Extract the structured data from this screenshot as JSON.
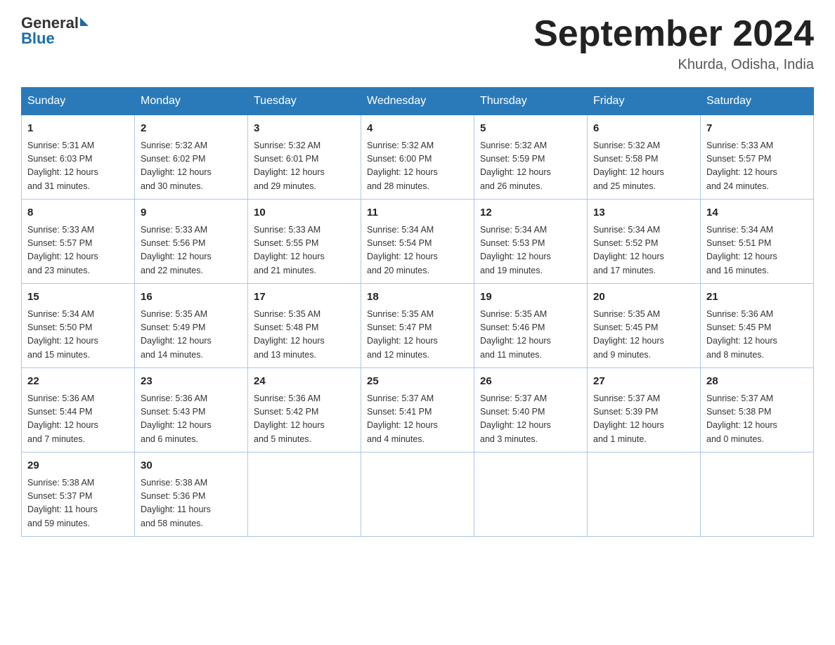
{
  "header": {
    "logo_general": "General",
    "logo_blue": "Blue",
    "title": "September 2024",
    "location": "Khurda, Odisha, India"
  },
  "days_of_week": [
    "Sunday",
    "Monday",
    "Tuesday",
    "Wednesday",
    "Thursday",
    "Friday",
    "Saturday"
  ],
  "weeks": [
    [
      {
        "day": "1",
        "sunrise": "5:31 AM",
        "sunset": "6:03 PM",
        "daylight": "12 hours and 31 minutes."
      },
      {
        "day": "2",
        "sunrise": "5:32 AM",
        "sunset": "6:02 PM",
        "daylight": "12 hours and 30 minutes."
      },
      {
        "day": "3",
        "sunrise": "5:32 AM",
        "sunset": "6:01 PM",
        "daylight": "12 hours and 29 minutes."
      },
      {
        "day": "4",
        "sunrise": "5:32 AM",
        "sunset": "6:00 PM",
        "daylight": "12 hours and 28 minutes."
      },
      {
        "day": "5",
        "sunrise": "5:32 AM",
        "sunset": "5:59 PM",
        "daylight": "12 hours and 26 minutes."
      },
      {
        "day": "6",
        "sunrise": "5:32 AM",
        "sunset": "5:58 PM",
        "daylight": "12 hours and 25 minutes."
      },
      {
        "day": "7",
        "sunrise": "5:33 AM",
        "sunset": "5:57 PM",
        "daylight": "12 hours and 24 minutes."
      }
    ],
    [
      {
        "day": "8",
        "sunrise": "5:33 AM",
        "sunset": "5:57 PM",
        "daylight": "12 hours and 23 minutes."
      },
      {
        "day": "9",
        "sunrise": "5:33 AM",
        "sunset": "5:56 PM",
        "daylight": "12 hours and 22 minutes."
      },
      {
        "day": "10",
        "sunrise": "5:33 AM",
        "sunset": "5:55 PM",
        "daylight": "12 hours and 21 minutes."
      },
      {
        "day": "11",
        "sunrise": "5:34 AM",
        "sunset": "5:54 PM",
        "daylight": "12 hours and 20 minutes."
      },
      {
        "day": "12",
        "sunrise": "5:34 AM",
        "sunset": "5:53 PM",
        "daylight": "12 hours and 19 minutes."
      },
      {
        "day": "13",
        "sunrise": "5:34 AM",
        "sunset": "5:52 PM",
        "daylight": "12 hours and 17 minutes."
      },
      {
        "day": "14",
        "sunrise": "5:34 AM",
        "sunset": "5:51 PM",
        "daylight": "12 hours and 16 minutes."
      }
    ],
    [
      {
        "day": "15",
        "sunrise": "5:34 AM",
        "sunset": "5:50 PM",
        "daylight": "12 hours and 15 minutes."
      },
      {
        "day": "16",
        "sunrise": "5:35 AM",
        "sunset": "5:49 PM",
        "daylight": "12 hours and 14 minutes."
      },
      {
        "day": "17",
        "sunrise": "5:35 AM",
        "sunset": "5:48 PM",
        "daylight": "12 hours and 13 minutes."
      },
      {
        "day": "18",
        "sunrise": "5:35 AM",
        "sunset": "5:47 PM",
        "daylight": "12 hours and 12 minutes."
      },
      {
        "day": "19",
        "sunrise": "5:35 AM",
        "sunset": "5:46 PM",
        "daylight": "12 hours and 11 minutes."
      },
      {
        "day": "20",
        "sunrise": "5:35 AM",
        "sunset": "5:45 PM",
        "daylight": "12 hours and 9 minutes."
      },
      {
        "day": "21",
        "sunrise": "5:36 AM",
        "sunset": "5:45 PM",
        "daylight": "12 hours and 8 minutes."
      }
    ],
    [
      {
        "day": "22",
        "sunrise": "5:36 AM",
        "sunset": "5:44 PM",
        "daylight": "12 hours and 7 minutes."
      },
      {
        "day": "23",
        "sunrise": "5:36 AM",
        "sunset": "5:43 PM",
        "daylight": "12 hours and 6 minutes."
      },
      {
        "day": "24",
        "sunrise": "5:36 AM",
        "sunset": "5:42 PM",
        "daylight": "12 hours and 5 minutes."
      },
      {
        "day": "25",
        "sunrise": "5:37 AM",
        "sunset": "5:41 PM",
        "daylight": "12 hours and 4 minutes."
      },
      {
        "day": "26",
        "sunrise": "5:37 AM",
        "sunset": "5:40 PM",
        "daylight": "12 hours and 3 minutes."
      },
      {
        "day": "27",
        "sunrise": "5:37 AM",
        "sunset": "5:39 PM",
        "daylight": "12 hours and 1 minute."
      },
      {
        "day": "28",
        "sunrise": "5:37 AM",
        "sunset": "5:38 PM",
        "daylight": "12 hours and 0 minutes."
      }
    ],
    [
      {
        "day": "29",
        "sunrise": "5:38 AM",
        "sunset": "5:37 PM",
        "daylight": "11 hours and 59 minutes."
      },
      {
        "day": "30",
        "sunrise": "5:38 AM",
        "sunset": "5:36 PM",
        "daylight": "11 hours and 58 minutes."
      },
      null,
      null,
      null,
      null,
      null
    ]
  ],
  "labels": {
    "sunrise_prefix": "Sunrise: ",
    "sunset_prefix": "Sunset: ",
    "daylight_prefix": "Daylight: "
  }
}
